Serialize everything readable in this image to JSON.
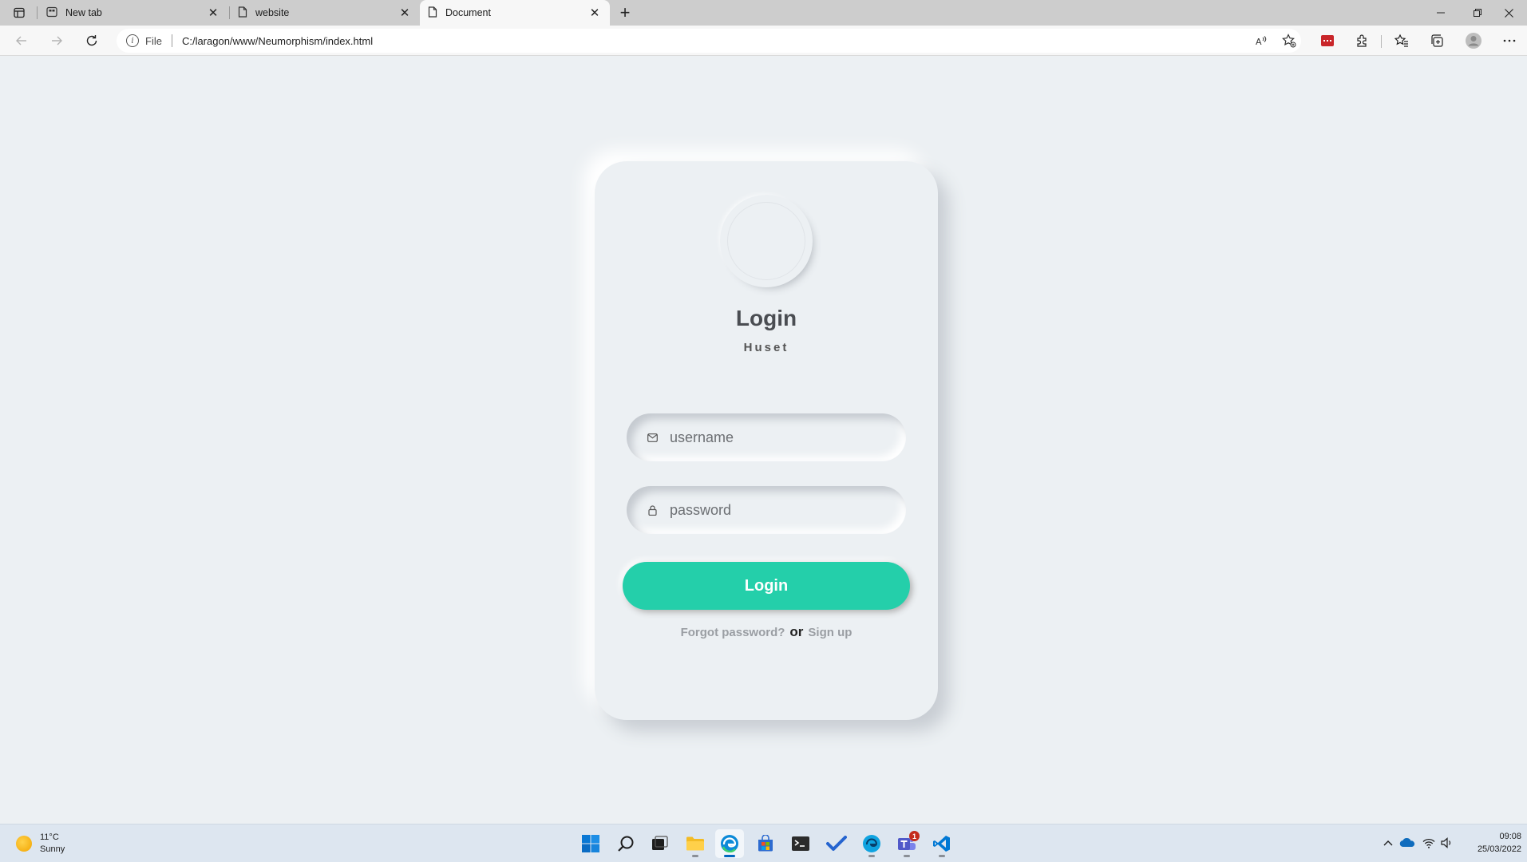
{
  "browser": {
    "tabs": [
      {
        "title": "New tab",
        "icon": "new-tab-page-icon",
        "active": false
      },
      {
        "title": "website",
        "icon": "page-icon",
        "active": false
      },
      {
        "title": "Document",
        "icon": "page-icon",
        "active": true
      }
    ],
    "close_glyph": "✕",
    "new_tab_glyph": "+",
    "address": {
      "scheme_label": "File",
      "url": "C:/laragon/www/Neumorphism/index.html"
    }
  },
  "login_card": {
    "title": "Login",
    "subtitle": "Huset",
    "username_placeholder": "username",
    "password_placeholder": "password",
    "button_label": "Login",
    "forgot_link": "Forgot password?",
    "or_text": "or",
    "signup_link": "Sign up",
    "accent_color": "#24cfaa",
    "background_color": "#ecf0f3"
  },
  "taskbar": {
    "weather": {
      "temperature": "11°C",
      "condition": "Sunny"
    },
    "clock": {
      "time": "09:08",
      "date": "25/03/2022"
    },
    "teams_badge": "1"
  }
}
